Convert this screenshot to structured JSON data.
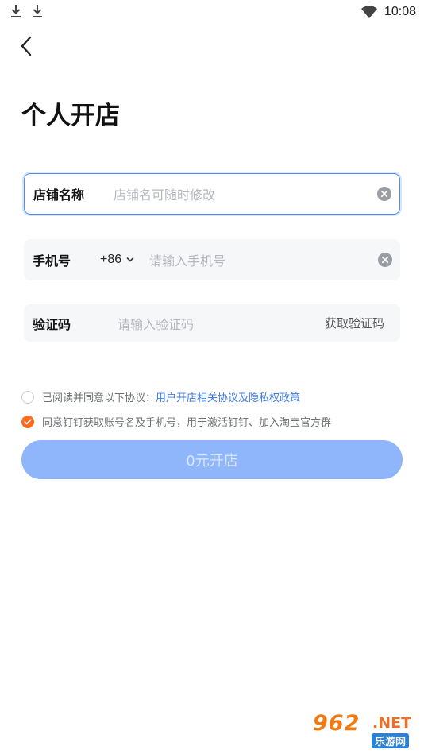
{
  "status_bar": {
    "time": "10:08"
  },
  "page": {
    "title": "个人开店"
  },
  "form": {
    "shop_name": {
      "label": "店铺名称",
      "placeholder": "店铺名可随时修改"
    },
    "phone": {
      "label": "手机号",
      "country_code": "+86",
      "placeholder": "请输入手机号"
    },
    "code": {
      "label": "验证码",
      "placeholder": "请输入验证码",
      "get_code": "获取验证码"
    }
  },
  "agreement": {
    "prefix": "已阅读并同意以下协议：",
    "link": "用户开店相关协议及隐私权政策",
    "consent": "同意钉钉获取账号名及手机号，用于激活钉钉、加入淘宝官方群"
  },
  "submit": {
    "label": "0元开店"
  },
  "watermark": {
    "brand": "962",
    "domain": ".NET",
    "site": "乐游网"
  },
  "colors": {
    "accent": "#4d8cf5",
    "button": "#8fb5fb",
    "checked": "#ff6a1a",
    "link": "#3f7be3"
  }
}
